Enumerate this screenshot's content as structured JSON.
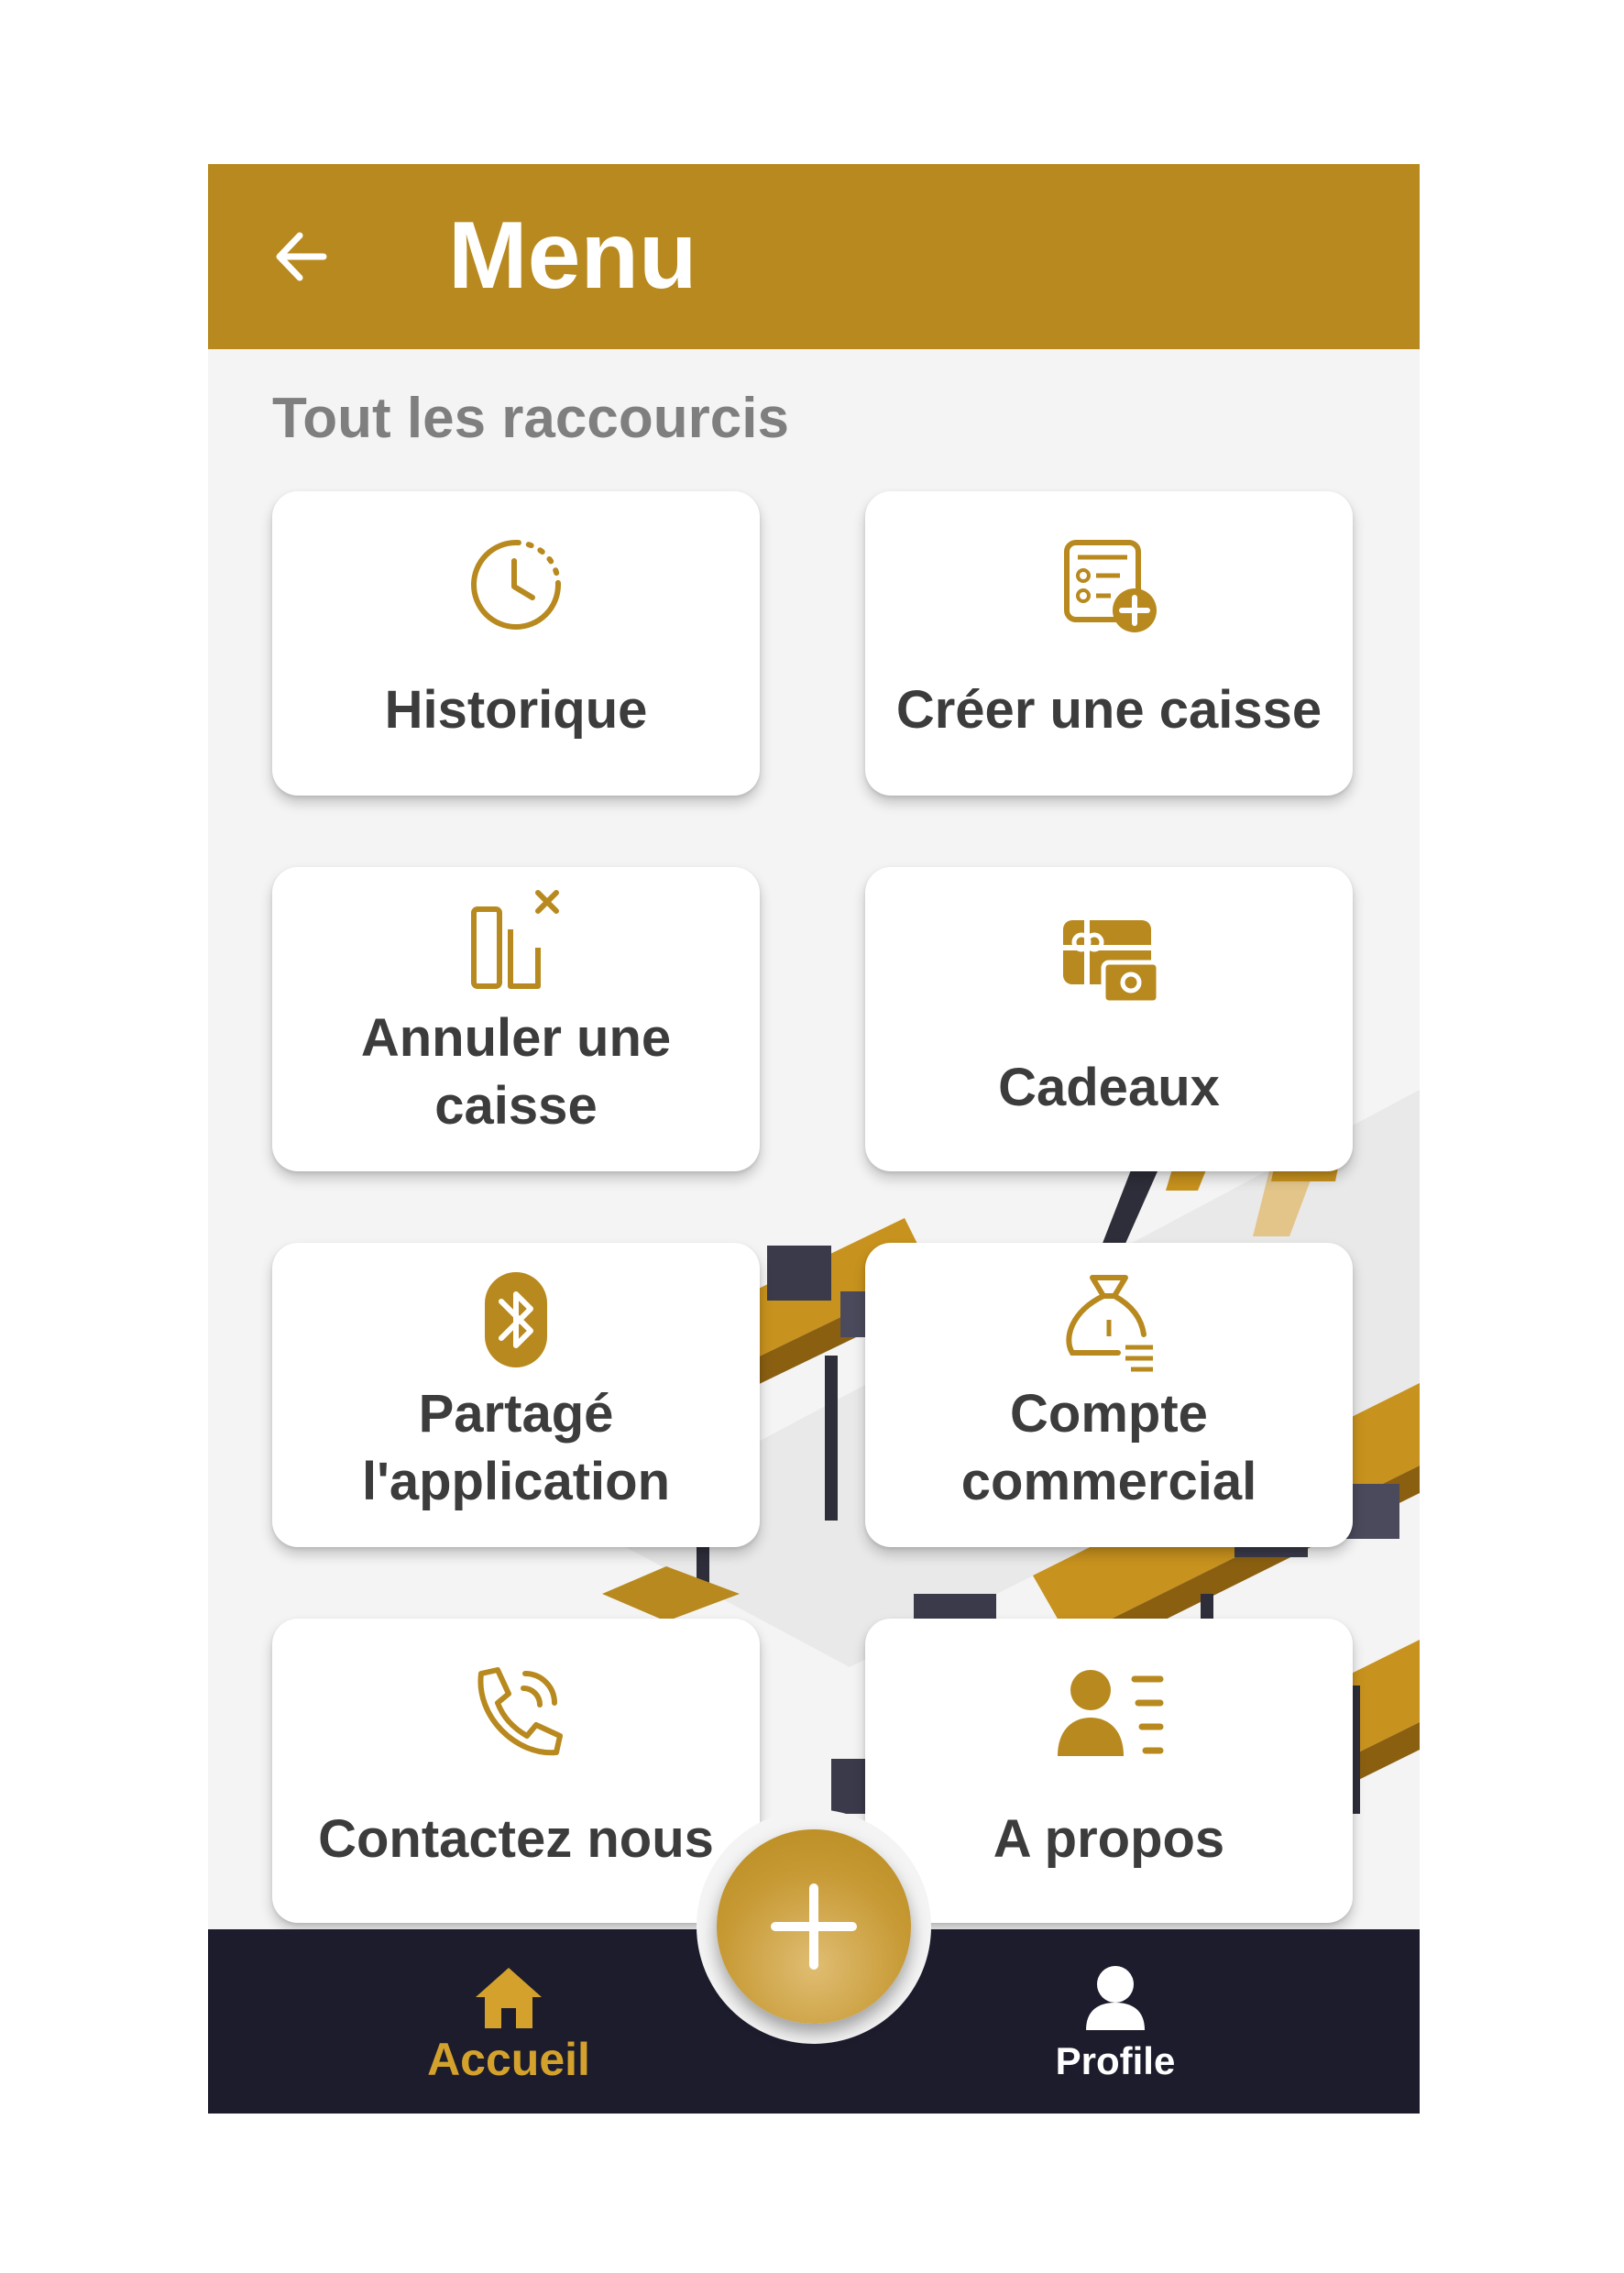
{
  "app_bar": {
    "title": "Menu",
    "back_icon": "arrow-left-icon"
  },
  "section": {
    "title": "Tout les raccourcis"
  },
  "shortcuts": [
    {
      "label": "Historique",
      "icon": "clock-history-icon"
    },
    {
      "label": "Créer une caisse",
      "icon": "create-register-icon"
    },
    {
      "label": "Annuler une caisse",
      "icon": "cancel-register-icon"
    },
    {
      "label": "Cadeaux",
      "icon": "gift-card-icon"
    },
    {
      "label": "Partagé l'application",
      "icon": "bluetooth-icon"
    },
    {
      "label": "Compte commercial",
      "icon": "money-bag-icon"
    },
    {
      "label": "Contactez nous",
      "icon": "phone-call-icon"
    },
    {
      "label": "A propos",
      "icon": "about-person-list-icon"
    }
  ],
  "fab": {
    "icon": "plus-icon"
  },
  "bottom_nav": {
    "items": [
      {
        "label": "Accueil",
        "icon": "home-icon",
        "active": true
      },
      {
        "label": "Profile",
        "icon": "user-icon",
        "active": false
      }
    ]
  },
  "colors": {
    "primary": "#b8891e",
    "background": "#f4f4f4",
    "tile": "#ffffff",
    "label": "#3c3c3c",
    "section_title": "#7f7f7f",
    "bottom_bar": "#1c1c2c",
    "nav_active": "#d4a22c",
    "nav_inactive": "#ffffff"
  }
}
